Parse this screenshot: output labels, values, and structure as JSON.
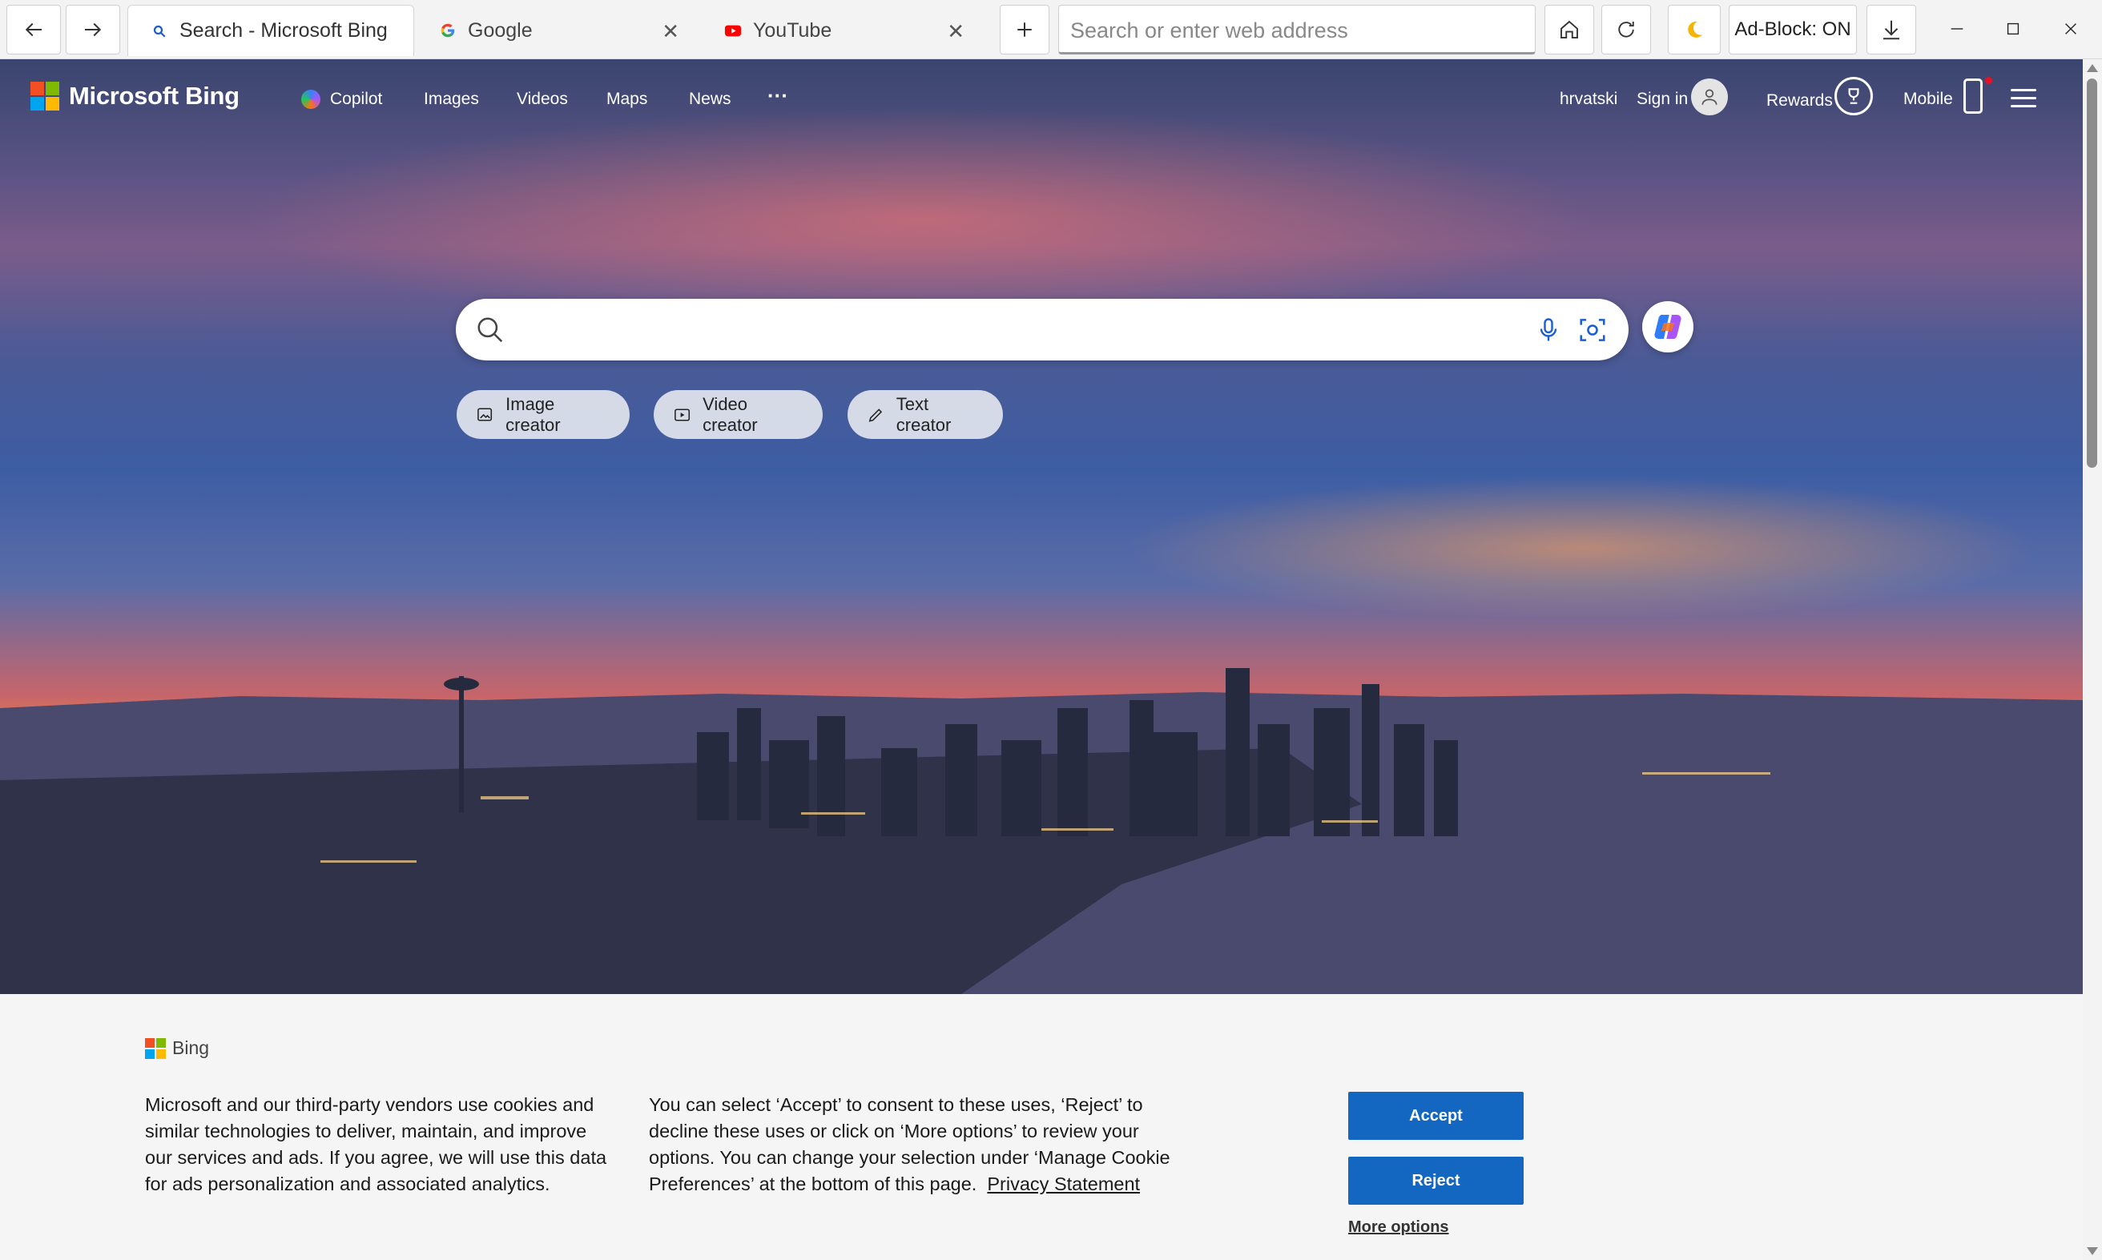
{
  "browser": {
    "tabs": [
      {
        "title": "Search - Microsoft Bing",
        "active": true
      },
      {
        "title": "Google",
        "active": false
      },
      {
        "title": "YouTube",
        "active": false
      }
    ],
    "address_placeholder": "Search or enter web address",
    "adblock_label": "Ad-Block: ON"
  },
  "bing": {
    "logo_text": "Microsoft Bing",
    "nav": [
      "Copilot",
      "Images",
      "Videos",
      "Maps",
      "News"
    ],
    "more_label": "···",
    "language": "hrvatski",
    "sign_in": "Sign in",
    "rewards": "Rewards",
    "mobile": "Mobile",
    "search_value": "",
    "creators": [
      "Image creator",
      "Video creator",
      "Text creator"
    ]
  },
  "cookie": {
    "brand": "Bing",
    "text_left": "Microsoft and our third-party vendors use cookies and similar technologies to deliver, maintain, and improve our services and ads. If you agree, we will use this data for ads personalization and associated analytics.",
    "text_right": "You can select ‘Accept’ to consent to these uses, ‘Reject’ to decline these uses or click on ‘More options’ to review your options. You can change your selection under ‘Manage Cookie Preferences’ at the bottom of this page.",
    "privacy_link": "Privacy Statement",
    "accept": "Accept",
    "reject": "Reject",
    "more_options": "More options"
  },
  "colors": {
    "accent_blue": "#1367c1",
    "ms_red": "#f25022",
    "ms_green": "#7fba00",
    "ms_blue": "#00a4ef",
    "ms_yellow": "#ffb900"
  }
}
